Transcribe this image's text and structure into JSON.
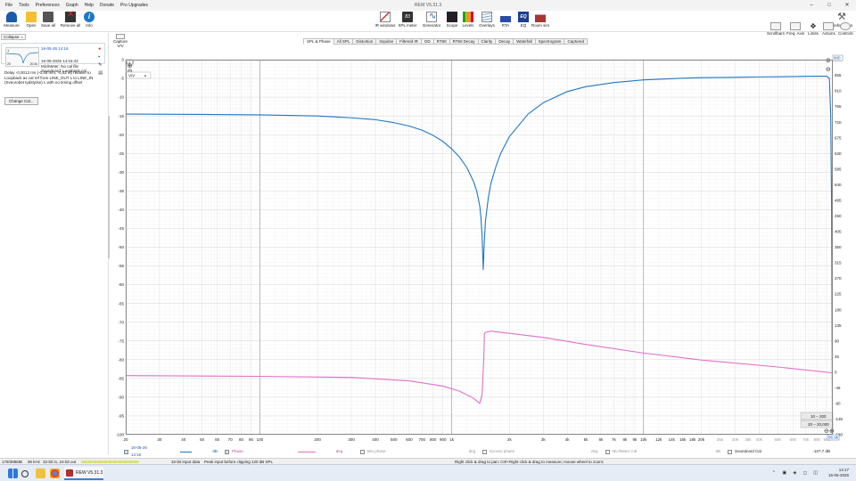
{
  "window": {
    "title": "REW V5.31.3"
  },
  "menu": [
    "File",
    "Tools",
    "Preferences",
    "Graph",
    "Help",
    "Donate",
    "Pro Upgrades"
  ],
  "toolbar": {
    "measure": "Measure",
    "open": "Open",
    "save_all": "Save all",
    "remove_all": "Remove all",
    "info": "Info",
    "ir_windows": "IR windows",
    "spl_meter": "SPL meter",
    "spl_value": "83",
    "generator": "Generator",
    "scope": "Scope",
    "levels": "Levels",
    "overlays": "Overlays",
    "rta": "RTA",
    "eq": "EQ",
    "eq_icon": "EQ",
    "room_sim": "Room sim",
    "preferences": "Preferences"
  },
  "right_tools": {
    "scrollbars": "Scrollbars",
    "freq_axis": "Freq. Axis",
    "limits": "Limits",
    "actions": "Actions",
    "controls": "Controls"
  },
  "left_panel": {
    "collapse": "Collapse",
    "measurement": {
      "number": "1",
      "header": "16-05-26 14:16",
      "date": "16-05-2026 14:16:42",
      "cal": "Mic/Meter: No cal file",
      "soundcard": "Soundcard: Loopback cal",
      "thumb_left": "20",
      "thumb_right": "20.0k"
    },
    "note": "Delay -0,0013 ms (-0,46 mm, -0,02 in) relative to Loopback as cal ref from LINE_OUT L to LINE_IN (Sveorobet tydstyrke) L with no timing offset",
    "change_cal": "Change Cal..."
  },
  "capture": {
    "label": "Capture",
    "unit": "V/V",
    "left_value": "14.7"
  },
  "tabs": [
    "SPL & Phase",
    "All SPL",
    "Distortion",
    "Impulse",
    "Filtered IR",
    "GD",
    "RT60",
    "RT60 Decay",
    "Clarity",
    "Decay",
    "Waterfall",
    "Spectrogram",
    "Captured"
  ],
  "selected_tab": "SPL & Phase",
  "graph": {
    "unit_selector": "V/V",
    "right_top_value": "900",
    "range_box_1": "10 – 200",
    "range_box_2": "20 – 20,000",
    "right_bottom_value": "96.9k"
  },
  "chart_data": {
    "type": "line",
    "xscale": "log",
    "xlim": [
      20,
      96900
    ],
    "ylim_left": [
      -100,
      0
    ],
    "ylim_right": [
      -180,
      900
    ],
    "x_ticks": [
      "20",
      "30",
      "40",
      "50",
      "60",
      "70",
      "80",
      "90",
      "100",
      "200",
      "300",
      "400",
      "500",
      "600",
      "700",
      "800",
      "900",
      "1k",
      "2k",
      "3k",
      "4k",
      "5k",
      "6k",
      "7k",
      "8k",
      "9k",
      "10k",
      "12k",
      "14k",
      "16k",
      "18k",
      "20k",
      "25k",
      "30k",
      "35k",
      "40k",
      "50k",
      "60k",
      "70k",
      "80k",
      "90k"
    ],
    "y_left_ticks": [
      "0",
      "-5",
      "-10",
      "-15",
      "-20",
      "-25",
      "-30",
      "-35",
      "-40",
      "-45",
      "-50",
      "-55",
      "-60",
      "-65",
      "-70",
      "-75",
      "-80",
      "-85",
      "-90",
      "-95",
      "-100"
    ],
    "y_right_ticks": [
      "900",
      "855",
      "810",
      "765",
      "720",
      "675",
      "630",
      "585",
      "540",
      "495",
      "450",
      "405",
      "360",
      "315",
      "270",
      "225",
      "180",
      "135",
      "90",
      "45",
      "0",
      "-45",
      "-90",
      "-135",
      "-180"
    ],
    "grid": true,
    "series": [
      {
        "name": "16-05-26 14:16",
        "unit": "dB",
        "color": "#1f77c4",
        "axis": "left",
        "x": [
          20,
          50,
          100,
          200,
          300,
          400,
          500,
          600,
          700,
          800,
          900,
          1000,
          1100,
          1200,
          1300,
          1350,
          1400,
          1420,
          1440,
          1460,
          1480,
          1500,
          1550,
          1600,
          1700,
          1800,
          2000,
          2500,
          3000,
          4000,
          5000,
          7000,
          10000,
          15000,
          20000,
          30000,
          40000,
          50000,
          60000,
          70000,
          80000,
          90000,
          93000,
          94500,
          95500,
          96500
        ],
        "y": [
          -14.5,
          -14.6,
          -14.7,
          -15,
          -15.5,
          -16,
          -16.8,
          -17.7,
          -18.8,
          -20.2,
          -21.8,
          -23.8,
          -26,
          -28.8,
          -32.5,
          -35,
          -39,
          -42,
          -47,
          -56,
          -48,
          -43,
          -37,
          -33,
          -28.5,
          -25,
          -20.5,
          -14.5,
          -11.5,
          -8.5,
          -7.2,
          -6.1,
          -5.4,
          -5,
          -4.8,
          -4.7,
          -4.6,
          -4.55,
          -4.5,
          -4.45,
          -4.4,
          -4.4,
          -5,
          -15,
          -40,
          -100
        ]
      },
      {
        "name": "Phase",
        "unit": "deg",
        "color": "#e070c8",
        "axis": "right",
        "x": [
          20,
          100,
          300,
          600,
          900,
          1100,
          1300,
          1400,
          1440,
          1470,
          1480,
          1500,
          1600,
          2000,
          3000,
          5000,
          10000,
          20000,
          50000,
          96900
        ],
        "y": [
          -10,
          -12,
          -15,
          -25,
          -40,
          -55,
          -75,
          -90,
          -65,
          40,
          110,
          115,
          118,
          112,
          100,
          80,
          55,
          35,
          15,
          -2
        ]
      }
    ]
  },
  "legend": {
    "m1_name": "16-05-26 14:16",
    "m1_unit": "dB",
    "phase": "Phase",
    "phase_unit": "deg",
    "min_phase": "Min phase",
    "min_phase_unit": "deg",
    "excess_phase": "Excess phase",
    "excess_phase_unit": "deg",
    "mic_cal": "Mic/Meter Cal",
    "mic_cal_unit": "dB",
    "soundcard_cal": "Soundcard Cal",
    "cursor_value": "-107,7 dB"
  },
  "status": {
    "memory": "179/399MB",
    "rate": "96 kHz",
    "bits": "32-bit in, 24-bit out",
    "input_meter": "IIIIIIIIIIIIIIIIIIIIIIIIIIIIIIIIIIIIIIIIIIIIIIIIIIIIIIIIIIIIIIIIIIIIIIIIIIII",
    "input_data": "32-bit input data",
    "peak": "Peak input before clipping 120 dB SPL",
    "hint": "Right click & drag to pan; Ctrl+Right click & drag to measure; mouse wheel to zoom;"
  },
  "taskbar": {
    "app": "REW V5.31.3",
    "time": "14:17",
    "date": "16-05-2026"
  }
}
